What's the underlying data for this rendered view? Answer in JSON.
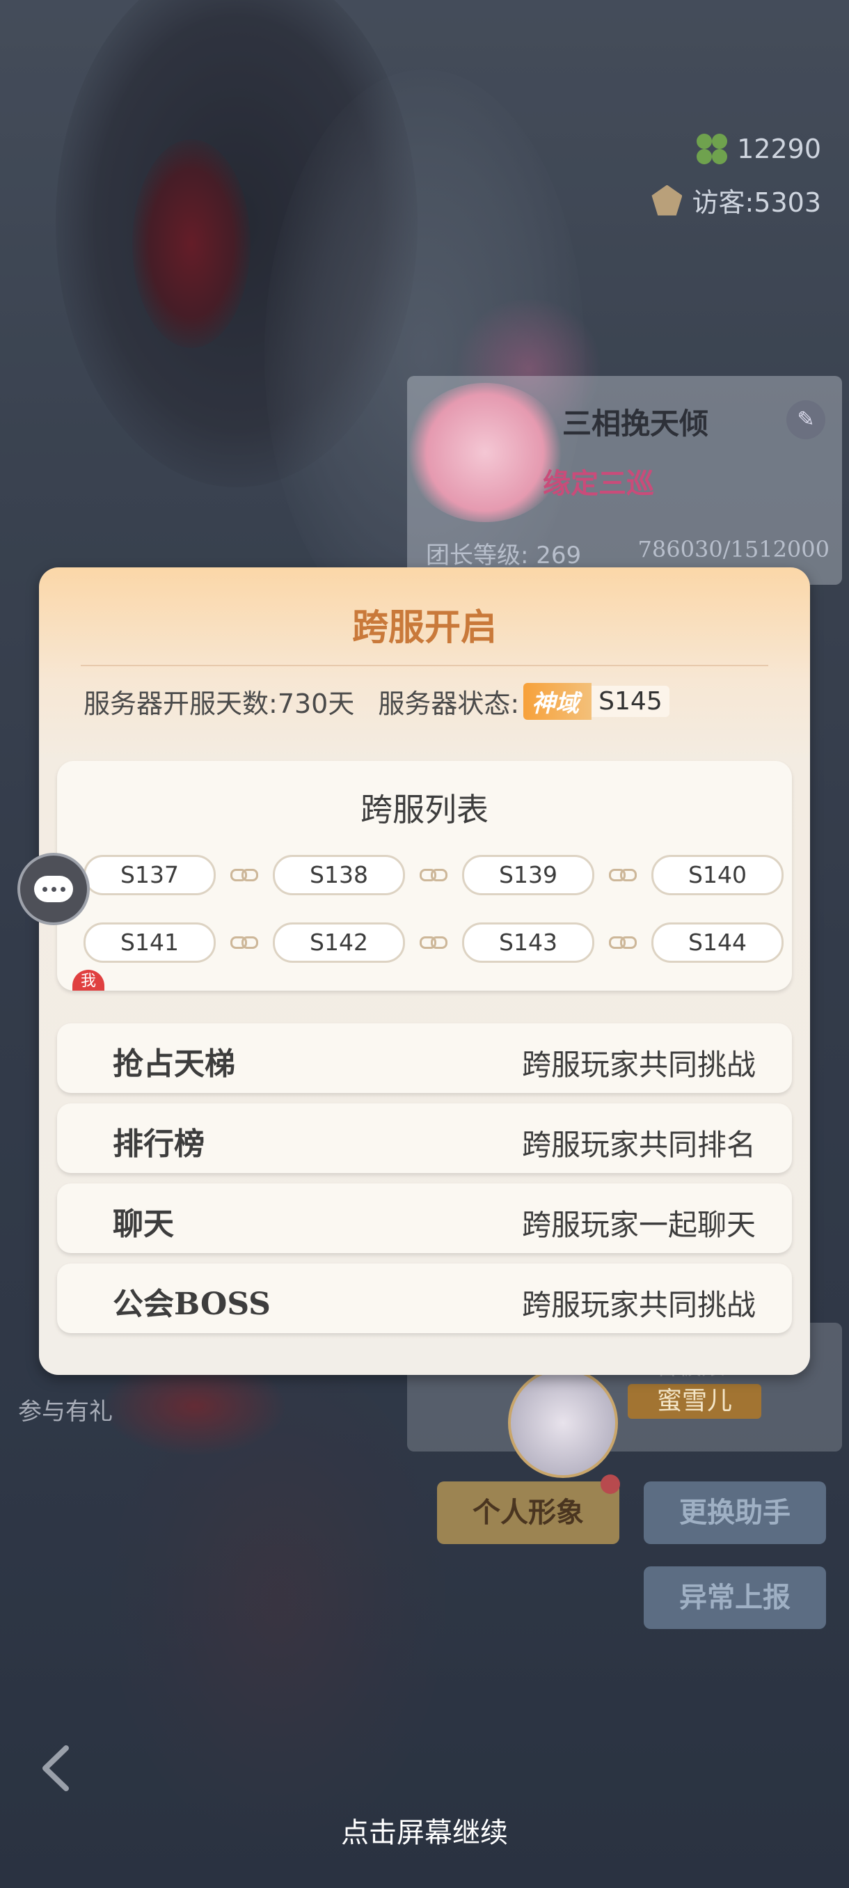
{
  "stats": {
    "clover_count": "12290",
    "visitors": "访客:5303"
  },
  "team": {
    "name": "三相挽天倾",
    "emblem_text": "缘定三巡",
    "level_label": "团长等级: 269",
    "exp": "786030/1512000"
  },
  "popup": {
    "title": "跨服开启",
    "server_days_label": "服务器开服天数:",
    "server_days_value": "730天",
    "server_status_label": "服务器状态:",
    "status_tag": "神域",
    "status_server": "S145",
    "list_title": "跨服列表",
    "servers_row1": [
      "S137",
      "S138",
      "S139",
      "S140"
    ],
    "servers_row2": [
      "S141",
      "S142",
      "S143",
      "S144"
    ],
    "me_badge": "我",
    "features": [
      {
        "name": "抢占天梯",
        "desc": "跨服玩家共同挑战"
      },
      {
        "name": "排行榜",
        "desc": "跨服玩家共同排名"
      },
      {
        "name": "聊天",
        "desc": "跨服玩家一起聊天"
      },
      {
        "name": "公会BOSS",
        "desc": "跨服玩家共同挑战"
      }
    ]
  },
  "background": {
    "side_label": "参与有礼",
    "helper_role": "看板娘",
    "helper_name": "蜜雪儿",
    "buttons": {
      "personal_image": "个人形象",
      "change_helper": "更换助手",
      "report": "异常上报"
    }
  },
  "footer": {
    "continue_text": "点击屏幕继续"
  },
  "colors": {
    "popup_title": "#c9793a",
    "status_tag": "#f7a13a",
    "accent_red": "#e04040"
  }
}
